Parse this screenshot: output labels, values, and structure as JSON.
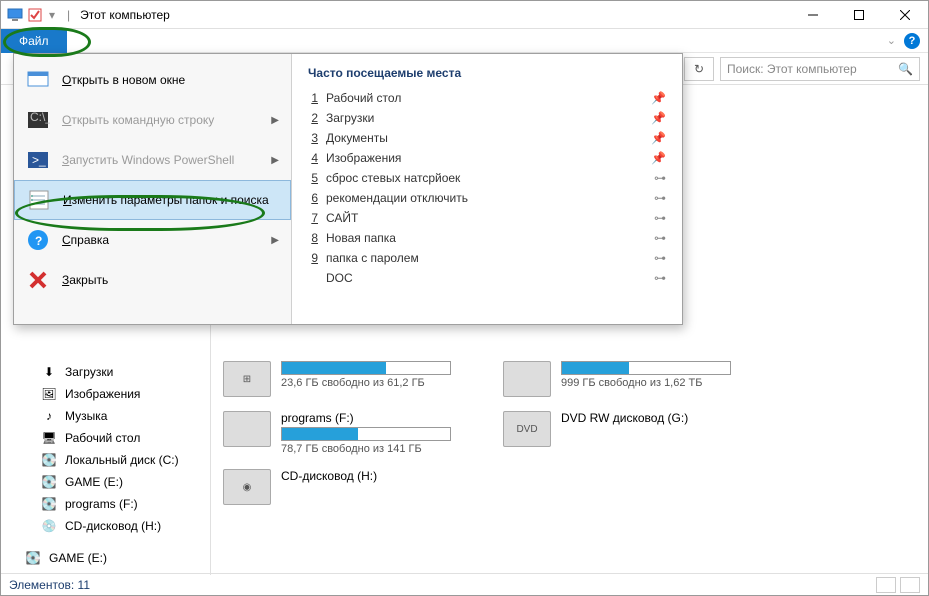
{
  "titlebar": {
    "title": "Этот компьютер"
  },
  "ribbon": {
    "file_label": "Файл"
  },
  "file_menu": {
    "items": [
      {
        "label": "Открыть в новом окне",
        "disabled": false,
        "arrow": false
      },
      {
        "label": "Открыть командную строку",
        "disabled": true,
        "arrow": true
      },
      {
        "label": "Запустить Windows PowerShell",
        "disabled": true,
        "arrow": true
      },
      {
        "label": "Изменить параметры папок и поиска",
        "disabled": false,
        "arrow": false,
        "highlight": true
      },
      {
        "label": "Справка",
        "disabled": false,
        "arrow": true
      },
      {
        "label": "Закрыть",
        "disabled": false,
        "arrow": false
      }
    ],
    "places_header": "Часто посещаемые места",
    "places": [
      {
        "idx": "1",
        "label": "Рабочий стол",
        "pinned": true
      },
      {
        "idx": "2",
        "label": "Загрузки",
        "pinned": true
      },
      {
        "idx": "3",
        "label": "Документы",
        "pinned": true
      },
      {
        "idx": "4",
        "label": "Изображения",
        "pinned": true
      },
      {
        "idx": "5",
        "label": "сброс стевых натсрйоек",
        "pinned": false
      },
      {
        "idx": "6",
        "label": "рекомендации отключить",
        "pinned": false
      },
      {
        "idx": "7",
        "label": "САЙТ",
        "pinned": false
      },
      {
        "idx": "8",
        "label": "Новая папка",
        "pinned": false
      },
      {
        "idx": "9",
        "label": "папка с паролем",
        "pinned": false
      },
      {
        "idx": "",
        "label": "DOC",
        "pinned": false
      }
    ]
  },
  "search": {
    "placeholder": "Поиск: Этот компьютер"
  },
  "sidebar": {
    "items": [
      {
        "label": "Загрузки",
        "icon": "⬇"
      },
      {
        "label": "Изображения",
        "icon": "🖼"
      },
      {
        "label": "Музыка",
        "icon": "♪"
      },
      {
        "label": "Рабочий стол",
        "icon": "🖥"
      },
      {
        "label": "Локальный диск (C:)",
        "icon": "💽"
      },
      {
        "label": "GAME (E:)",
        "icon": "💽"
      },
      {
        "label": "programs (F:)",
        "icon": "💽"
      },
      {
        "label": "CD-дисковод (H:)",
        "icon": "💿"
      }
    ],
    "bottom": {
      "label": "GAME (E:)",
      "icon": "💽"
    }
  },
  "drives": {
    "row1": [
      {
        "title": "",
        "free": "23,6 ГБ свободно из 61,2 ГБ",
        "fill": 62,
        "icon": "win"
      },
      {
        "title": "",
        "free": "999 ГБ свободно из 1,62 ТБ",
        "fill": 40,
        "icon": "hdd"
      }
    ],
    "row2": [
      {
        "title": "programs (F:)",
        "free": "78,7 ГБ свободно из 141 ГБ",
        "fill": 45,
        "icon": "hdd"
      },
      {
        "title": "DVD RW дисковод (G:)",
        "free": "",
        "fill": 0,
        "icon": "dvd",
        "nobar": true
      }
    ],
    "row3": [
      {
        "title": "CD-дисковод (H:)",
        "free": "",
        "fill": 0,
        "icon": "cd",
        "nobar": true
      }
    ]
  },
  "statusbar": {
    "text": "Элементов: 11"
  }
}
